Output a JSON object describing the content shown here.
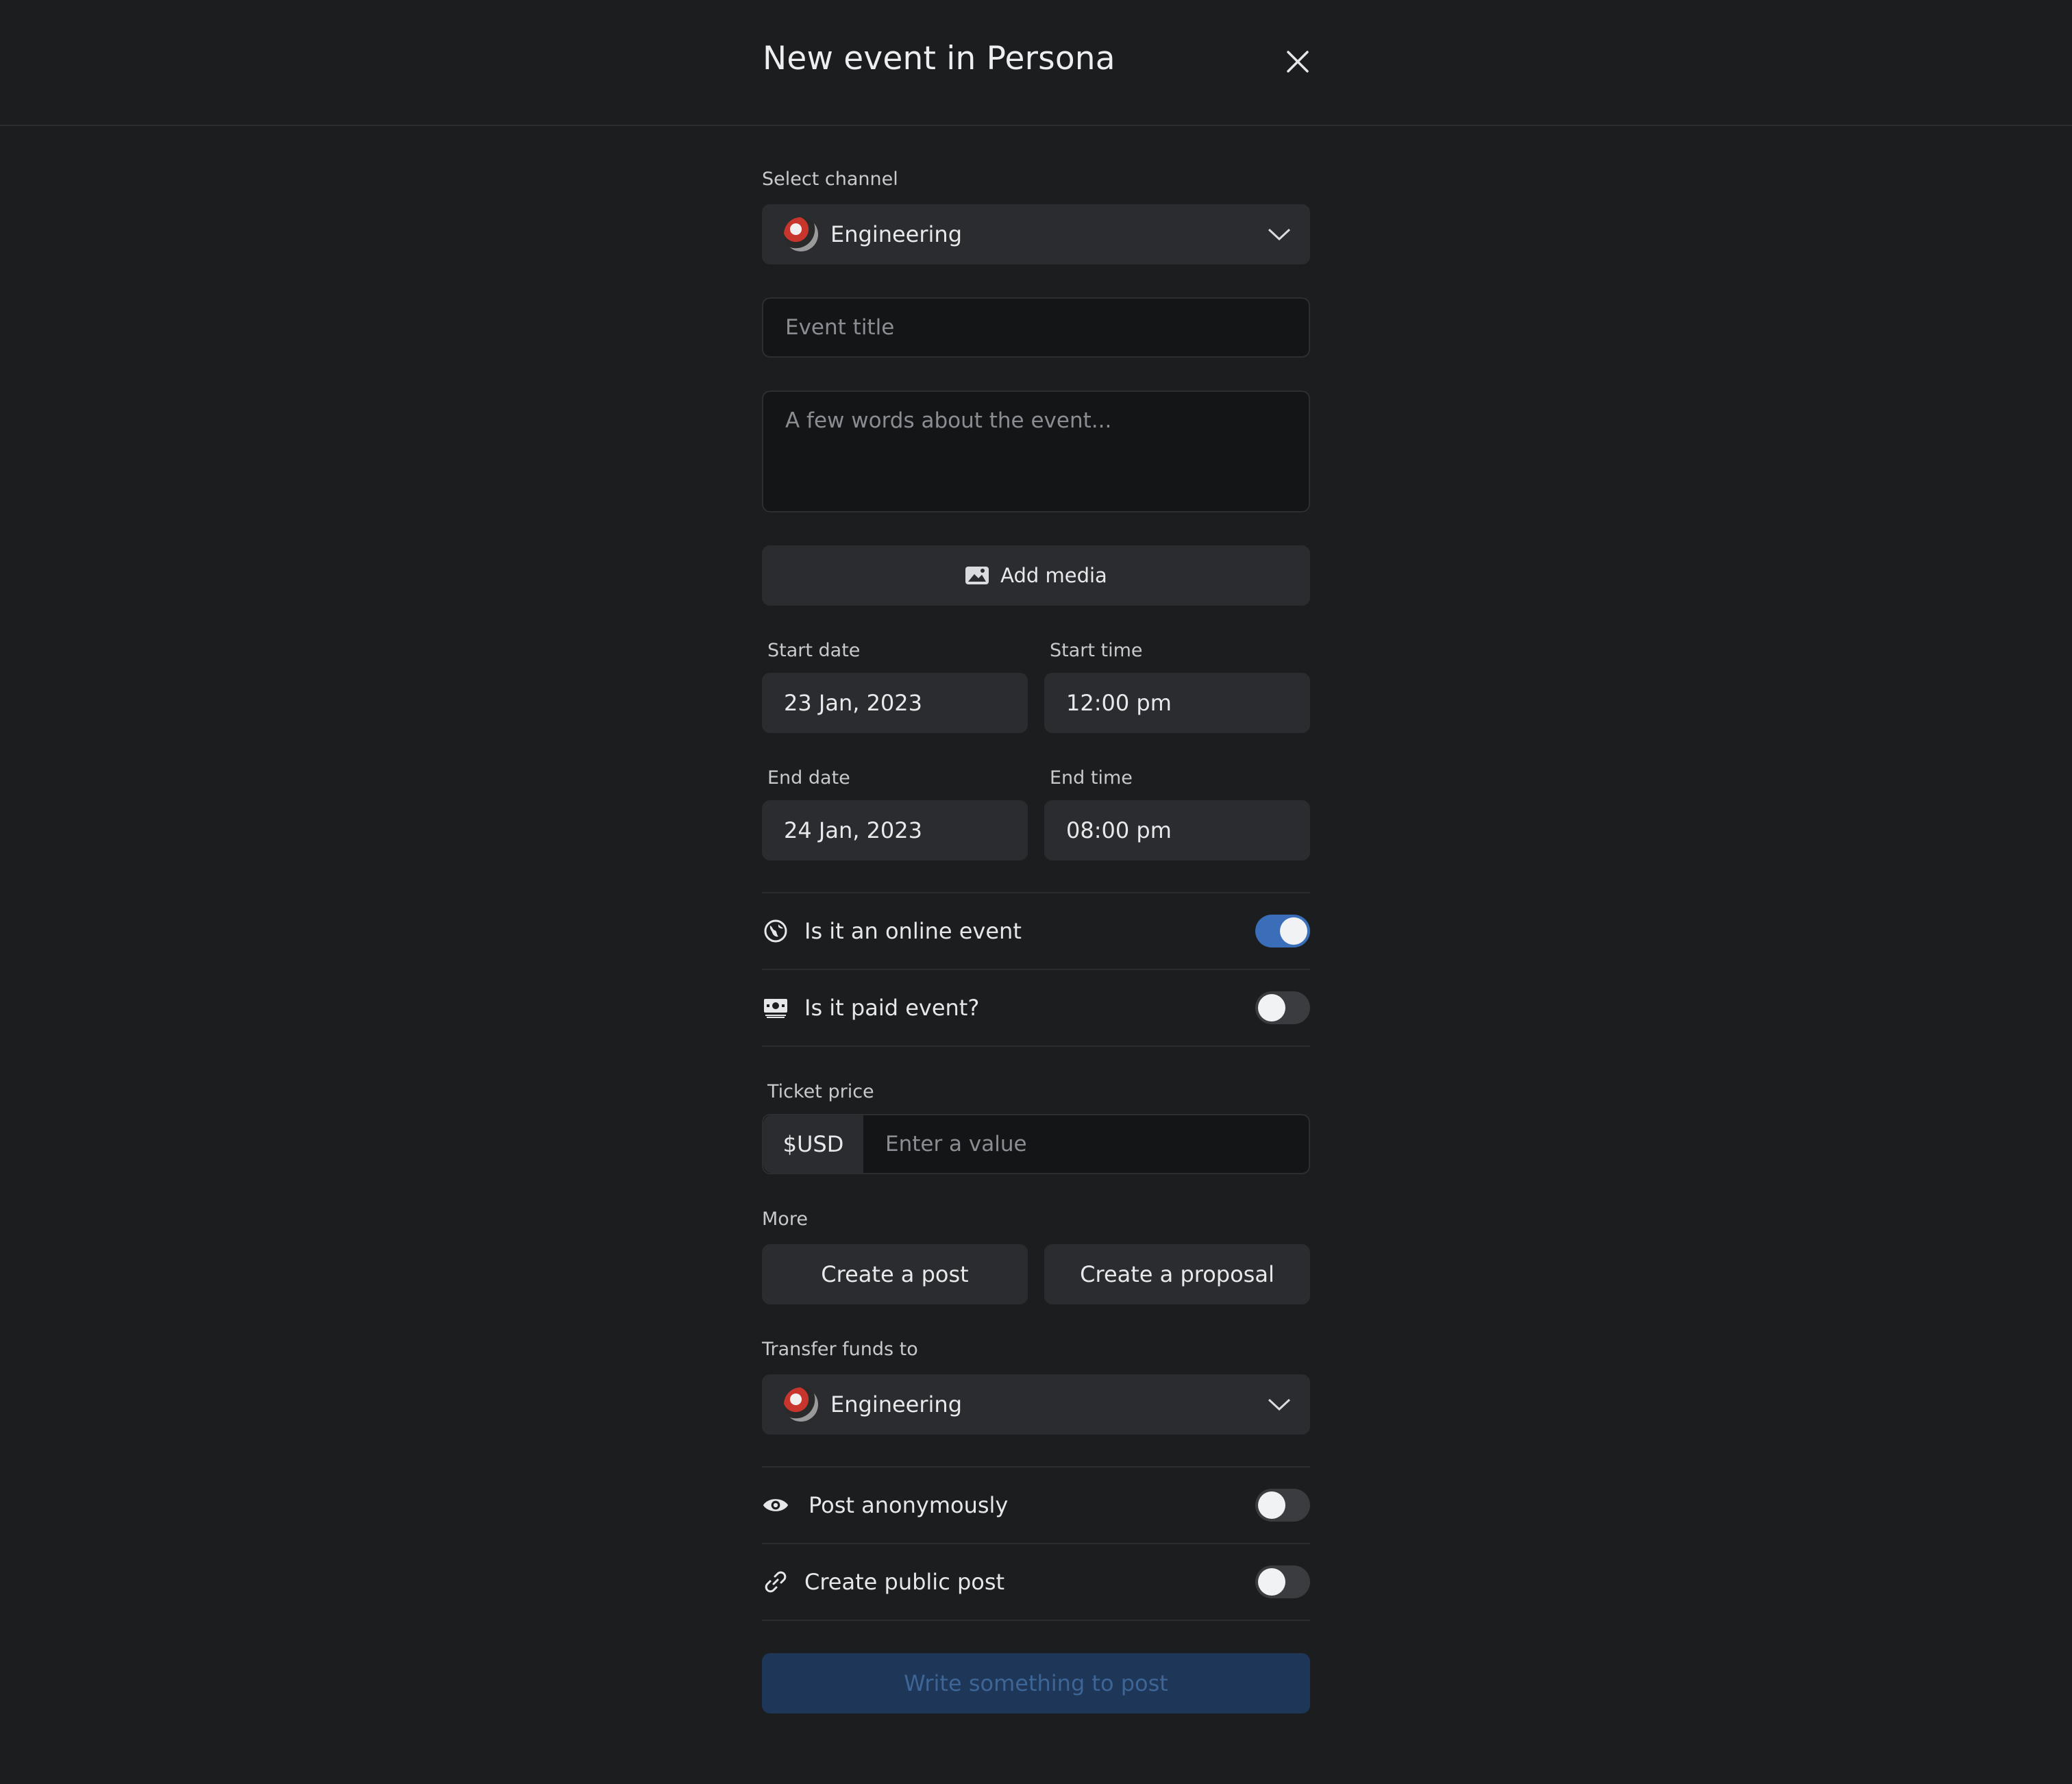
{
  "header": {
    "title": "New event in Persona"
  },
  "channel": {
    "label": "Select channel",
    "value": "Engineering"
  },
  "event_title": {
    "placeholder": "Event title"
  },
  "description": {
    "placeholder": "A few words about the event..."
  },
  "media": {
    "label": "Add media"
  },
  "dates": {
    "start_date_label": "Start date",
    "start_date": "23 Jan, 2023",
    "start_time_label": "Start time",
    "start_time": "12:00 pm",
    "end_date_label": "End date",
    "end_date": "24 Jan, 2023",
    "end_time_label": "End time",
    "end_time": "08:00 pm"
  },
  "toggles": {
    "online": {
      "label": "Is it an online event",
      "on": true
    },
    "paid": {
      "label": "Is it paid event?",
      "on": false
    },
    "anonymous": {
      "label": "Post anonymously",
      "on": false
    },
    "public": {
      "label": "Create public post",
      "on": false
    }
  },
  "ticket": {
    "label": "Ticket price",
    "currency": "$USD",
    "placeholder": "Enter a value"
  },
  "more": {
    "label": "More",
    "create_post": "Create a post",
    "create_proposal": "Create a proposal"
  },
  "transfer": {
    "label": "Transfer funds to",
    "value": "Engineering"
  },
  "submit": {
    "label": "Write something to post"
  },
  "colors": {
    "background": "#1c1d1f",
    "field": "#2a2c2f",
    "accent": "#3a6eb8",
    "submit_bg": "#1e3658"
  }
}
